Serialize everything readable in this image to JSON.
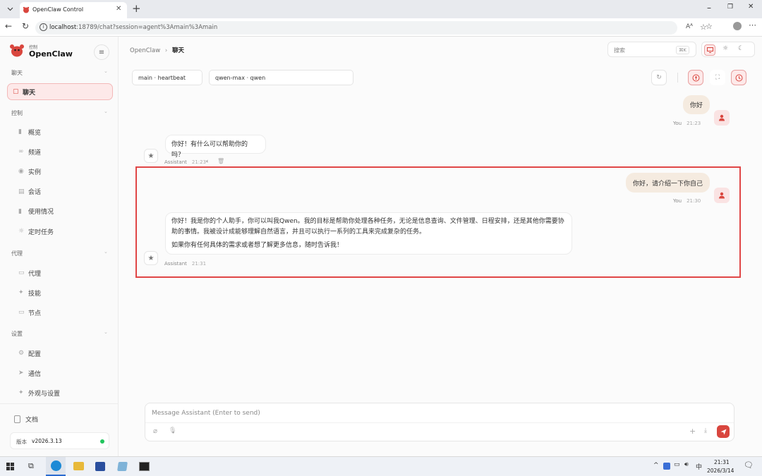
{
  "browser": {
    "tab_title": "OpenClaw Control",
    "url_host": "localhost",
    "url_rest": ":18789/chat?session=agent%3Amain%3Amain"
  },
  "brand": {
    "small": "控制",
    "name": "OpenClaw"
  },
  "sidebar": {
    "sections": [
      {
        "title": "聊天",
        "items": [
          {
            "label": "聊天",
            "icon": "chat-icon",
            "active": true
          }
        ]
      },
      {
        "title": "控制",
        "items": [
          {
            "label": "概览",
            "icon": "bar-chart-icon"
          },
          {
            "label": "频道",
            "icon": "link-icon"
          },
          {
            "label": "实例",
            "icon": "radio-icon"
          },
          {
            "label": "会话",
            "icon": "document-icon"
          },
          {
            "label": "使用情况",
            "icon": "bar-chart-icon"
          },
          {
            "label": "定时任务",
            "icon": "sun-icon"
          }
        ]
      },
      {
        "title": "代理",
        "items": [
          {
            "label": "代理",
            "icon": "folder-icon"
          },
          {
            "label": "技能",
            "icon": "sparkle-icon"
          },
          {
            "label": "节点",
            "icon": "monitor-icon"
          }
        ]
      },
      {
        "title": "设置",
        "items": [
          {
            "label": "配置",
            "icon": "gear-icon"
          },
          {
            "label": "通信",
            "icon": "send-icon"
          },
          {
            "label": "外观与设置",
            "icon": "sparkle-icon"
          }
        ]
      }
    ],
    "docs_label": "文档",
    "version_label": "版本",
    "version_value": "v2026.3.13",
    "status_color": "#22c55e"
  },
  "topbar": {
    "breadcrumb_root": "OpenClaw",
    "breadcrumb_sep": "›",
    "breadcrumb_current": "聊天",
    "search_placeholder": "搜索",
    "search_shortcut": "⌘K"
  },
  "chat": {
    "session_chip": "main · heartbeat",
    "model_chip": "qwen-max · qwen",
    "messages": [
      {
        "role": "user",
        "text": "你好",
        "sender": "You",
        "time": "21:23"
      },
      {
        "role": "assistant",
        "text": "你好！有什么可以帮助你的吗？",
        "sender": "Assistant",
        "time": "21:23"
      },
      {
        "role": "user",
        "text": "你好，请介绍一下你自己",
        "sender": "You",
        "time": "21:30"
      },
      {
        "role": "assistant",
        "paragraphs": [
          "你好！我是你的个人助手，你可以叫我Qwen。我的目标是帮助你处理各种任务，无论是信息查询、文件管理、日程安排，还是其他你需要协助的事情。我被设计成能够理解自然语言，并且可以执行一系列的工具来完成复杂的任务。",
          "如果你有任何具体的需求或者想了解更多信息，随时告诉我！"
        ],
        "sender": "Assistant",
        "time": "21:31"
      }
    ],
    "input_placeholder": "Message Assistant (Enter to send)"
  },
  "highlight_color": "#e04646",
  "accent": "#d9463e",
  "taskbar": {
    "time": "21:31",
    "date": "2026/3/14",
    "ime": "中"
  }
}
